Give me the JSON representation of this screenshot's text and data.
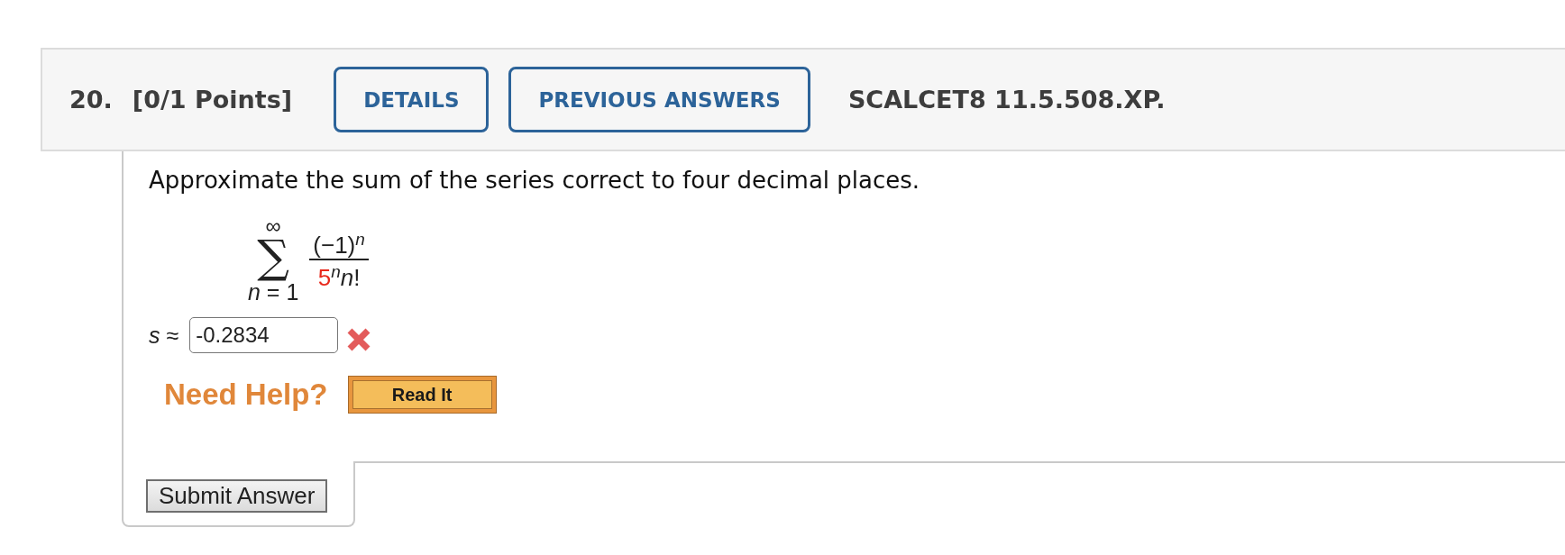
{
  "question": {
    "number": "20.",
    "points": "[0/1 Points]",
    "buttons": [
      {
        "label": "DETAILS"
      },
      {
        "label": "PREVIOUS ANSWERS"
      }
    ],
    "code": "SCALCET8 11.5.508.XP."
  },
  "prompt": "Approximate the sum of the series correct to four decimal places.",
  "series": {
    "upper_limit": "∞",
    "symbol": "∑",
    "lower_limit": "*n* = 1",
    "numerator": "(−1)$^{n}$",
    "denominator": [
      {
        "text": "5",
        "highlighted": true
      },
      {
        "text": "$^{n}$*n*!",
        "highlighted": false
      }
    ]
  },
  "answer": {
    "label": "*s* ≈",
    "value": "-0.2834",
    "correct": false
  },
  "help": {
    "title": "Need Help?",
    "buttons": [
      {
        "label": "Read It"
      }
    ]
  },
  "submit": {
    "label": "Submit Answer"
  }
}
